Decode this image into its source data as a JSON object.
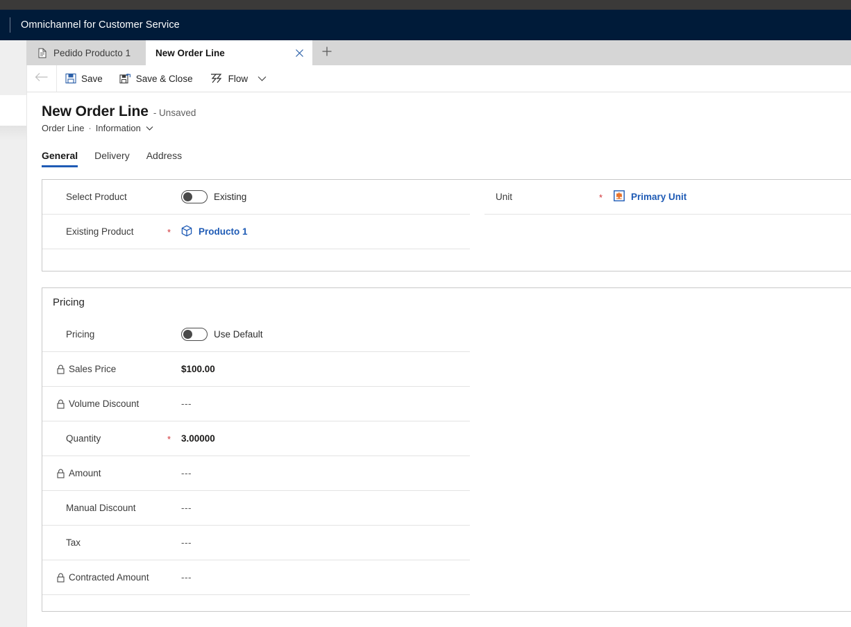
{
  "app": {
    "title": "Omnichannel for Customer Service"
  },
  "tabs": {
    "inactive": {
      "label": "Pedido Producto 1",
      "icon": "document-icon"
    },
    "active": {
      "label": "New Order Line",
      "close_icon": "close-icon"
    },
    "new_tab_icon": "plus-icon"
  },
  "command_bar": {
    "back_icon": "back-arrow-icon",
    "buttons": [
      {
        "label": "Save",
        "icon": "save-icon"
      },
      {
        "label": "Save & Close",
        "icon": "save-and-close-icon"
      },
      {
        "label": "Flow",
        "icon": "flow-icon"
      }
    ],
    "overflow_icon": "chevron-down-icon"
  },
  "header": {
    "title": "New Order Line",
    "status": "- Unsaved",
    "entity": "Order Line",
    "separator": "·",
    "form": "Information",
    "form_chevron_icon": "chevron-down-icon"
  },
  "form_tabs": [
    {
      "label": "General",
      "selected": true
    },
    {
      "label": "Delivery",
      "selected": false
    },
    {
      "label": "Address",
      "selected": false
    }
  ],
  "general": {
    "left_rows": [
      {
        "label": "Select Product",
        "required": "",
        "type": "toggle",
        "toggle_state": "off",
        "value": "Existing"
      },
      {
        "label": "Existing Product",
        "required": "*",
        "type": "lookup",
        "icon": "product-box-icon",
        "value": "Producto 1"
      }
    ],
    "right_rows": [
      {
        "label": "Unit",
        "required": "*",
        "type": "lookup",
        "icon": "unit-group-icon",
        "value": "Primary Unit"
      }
    ]
  },
  "pricing": {
    "section_title": "Pricing",
    "rows": [
      {
        "label": "Pricing",
        "locked": false,
        "required": "",
        "type": "toggle",
        "toggle_state": "off",
        "value": "Use Default"
      },
      {
        "label": "Sales Price",
        "locked": true,
        "lock_icon": "lock-icon",
        "required": "",
        "type": "text",
        "value": "$100.00",
        "bold": true
      },
      {
        "label": "Volume Discount",
        "locked": true,
        "lock_icon": "lock-icon",
        "required": "",
        "type": "text",
        "value": "---"
      },
      {
        "label": "Quantity",
        "locked": false,
        "required": "*",
        "type": "text",
        "value": "3.00000",
        "bold": true
      },
      {
        "label": "Amount",
        "locked": true,
        "lock_icon": "lock-icon",
        "required": "",
        "type": "text",
        "value": "---"
      },
      {
        "label": "Manual Discount",
        "locked": false,
        "required": "",
        "type": "text",
        "value": "---"
      },
      {
        "label": "Tax",
        "locked": false,
        "required": "",
        "type": "text",
        "value": "---"
      },
      {
        "label": "Contracted Amount",
        "locked": true,
        "lock_icon": "lock-icon",
        "required": "",
        "type": "text",
        "value": "---"
      }
    ]
  },
  "colors": {
    "app_bar": "#001b39",
    "accent": "#1f5bb5",
    "required": "#d13438",
    "os_strip": "#3b3a39"
  }
}
